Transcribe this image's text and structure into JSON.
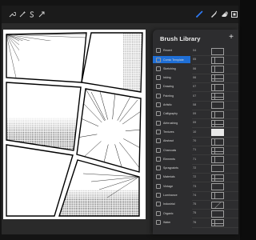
{
  "toolbar": {
    "left_icons": [
      "wrench-icon",
      "magic-wand-icon",
      "selection-s-icon",
      "move-arrow-icon"
    ],
    "right_icons": [
      "brush-icon",
      "smudge-icon",
      "eraser-icon",
      "layers-icon"
    ],
    "active_tool": "brush-icon",
    "accent": "#2f7bf6"
  },
  "panel": {
    "title": "Brush Library",
    "add_label": "+",
    "categories": [
      {
        "label": "Recent",
        "active": false
      },
      {
        "label": "Comic Template",
        "active": true
      },
      {
        "label": "Sketching",
        "active": false
      },
      {
        "label": "Inking",
        "active": false
      },
      {
        "label": "Drawing",
        "active": false
      },
      {
        "label": "Painting",
        "active": false
      },
      {
        "label": "Artistic",
        "active": false
      },
      {
        "label": "Calligraphy",
        "active": false
      },
      {
        "label": "Airbrushing",
        "active": false
      },
      {
        "label": "Textures",
        "active": false
      },
      {
        "label": "Abstract",
        "active": false
      },
      {
        "label": "Charcoals",
        "active": false
      },
      {
        "label": "Elements",
        "active": false
      },
      {
        "label": "Spraypaints",
        "active": false
      },
      {
        "label": "Materials",
        "active": false
      },
      {
        "label": "Vintage",
        "active": false
      },
      {
        "label": "Luminance",
        "active": false
      },
      {
        "label": "Industrial",
        "active": false
      },
      {
        "label": "Organic",
        "active": false
      },
      {
        "label": "Water",
        "active": false
      }
    ],
    "brushes": [
      {
        "number": "04",
        "style": "plain"
      },
      {
        "number": "05",
        "style": "split"
      },
      {
        "number": "06",
        "style": "split"
      },
      {
        "number": "06",
        "style": "grid"
      },
      {
        "number": "07",
        "style": "split"
      },
      {
        "number": "07",
        "style": "grid"
      },
      {
        "number": "08",
        "style": "plain"
      },
      {
        "number": "09",
        "style": "split"
      },
      {
        "number": "09",
        "style": "grid"
      },
      {
        "number": "10",
        "style": "bright"
      },
      {
        "number": "70",
        "style": "split"
      },
      {
        "number": "71",
        "style": "grid"
      },
      {
        "number": "71",
        "style": "split"
      },
      {
        "number": "72",
        "style": "plain"
      },
      {
        "number": "72",
        "style": "grid"
      },
      {
        "number": "73",
        "style": "plain"
      },
      {
        "number": "74",
        "style": "split"
      },
      {
        "number": "75",
        "style": "diag"
      },
      {
        "number": "75",
        "style": "plain"
      },
      {
        "number": "76",
        "style": "grid"
      }
    ]
  }
}
